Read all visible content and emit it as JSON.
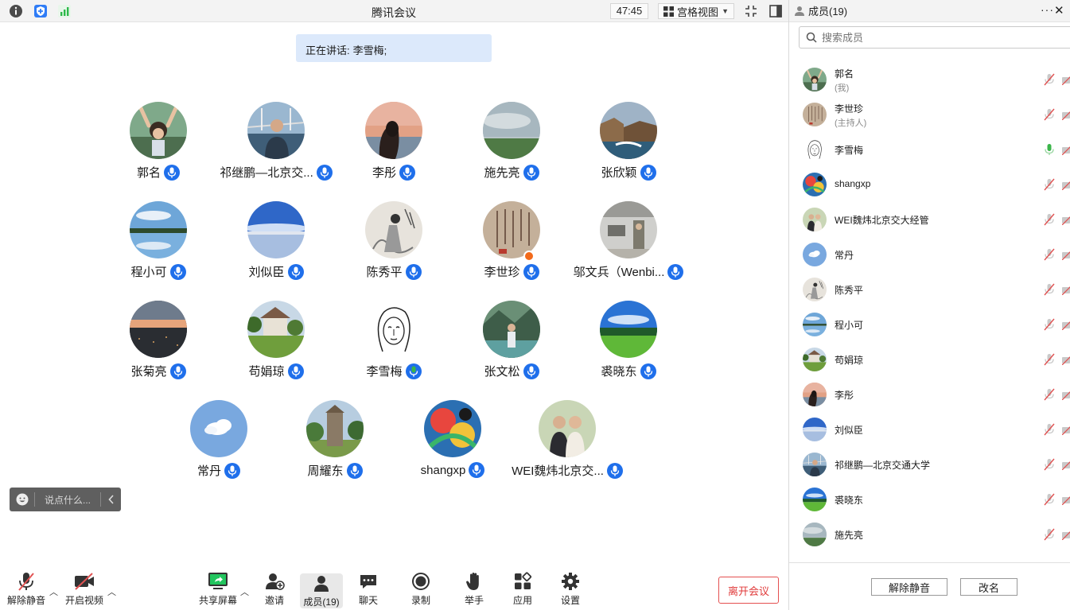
{
  "topbar": {
    "title": "腾讯会议",
    "timer": "47:45",
    "view_mode": "宫格视图"
  },
  "speaking": {
    "label": "正在讲话:",
    "name": "李雪梅;"
  },
  "participants": [
    {
      "name": "郭名",
      "avatar": "child-photo"
    },
    {
      "name": "祁继鹏—北京交...",
      "avatar": "bridge-portrait"
    },
    {
      "name": "李彤",
      "avatar": "sunset-portrait"
    },
    {
      "name": "施先亮",
      "avatar": "prairie-sky"
    },
    {
      "name": "张欣颖",
      "avatar": "coastal-cliffs"
    },
    {
      "name": "程小可",
      "avatar": "lake-reflection"
    },
    {
      "name": "刘似臣",
      "avatar": "salt-lake"
    },
    {
      "name": "陈秀平",
      "avatar": "ink-painting"
    },
    {
      "name": "李世珍",
      "avatar": "calligraphy",
      "host": true
    },
    {
      "name": "邬文兵（Wenbi...",
      "avatar": "gallery"
    },
    {
      "name": "张菊亮",
      "avatar": "dusk-city"
    },
    {
      "name": "苟娟琼",
      "avatar": "garden-pavilion"
    },
    {
      "name": "李雪梅",
      "avatar": "sketch-face",
      "speaking": true
    },
    {
      "name": "张文松",
      "avatar": "mountain-person"
    },
    {
      "name": "裘晓东",
      "avatar": "green-field"
    },
    {
      "name": "常丹",
      "avatar": "blue-cloud"
    },
    {
      "name": "周耀东",
      "avatar": "tower"
    },
    {
      "name": "shangxp",
      "avatar": "colorful-art"
    },
    {
      "name": "WEI魏炜北京交...",
      "avatar": "couple"
    }
  ],
  "chat": {
    "placeholder": "说点什么..."
  },
  "toolbar": {
    "unmute": "解除静音",
    "video": "开启视频",
    "share": "共享屏幕",
    "invite": "邀请",
    "members": "成员(19)",
    "chat": "聊天",
    "record": "录制",
    "raise_hand": "举手",
    "apps": "应用",
    "settings": "设置",
    "leave": "离开会议"
  },
  "panel": {
    "title": "成员(19)",
    "more": "···",
    "search_placeholder": "搜索成员",
    "members": [
      {
        "name": "郭名",
        "role": "(我)",
        "avatar": "child-photo"
      },
      {
        "name": "李世珍",
        "role": "(主持人)",
        "avatar": "calligraphy"
      },
      {
        "name": "李雪梅",
        "avatar": "sketch-face",
        "speaking": true
      },
      {
        "name": "shangxp",
        "avatar": "colorful-art"
      },
      {
        "name": "WEI魏炜北京交大经管",
        "avatar": "couple"
      },
      {
        "name": "常丹",
        "avatar": "blue-cloud"
      },
      {
        "name": "陈秀平",
        "avatar": "ink-painting"
      },
      {
        "name": "程小可",
        "avatar": "lake-reflection"
      },
      {
        "name": "苟娟琼",
        "avatar": "garden-pavilion"
      },
      {
        "name": "李彤",
        "avatar": "sunset-portrait"
      },
      {
        "name": "刘似臣",
        "avatar": "salt-lake"
      },
      {
        "name": "祁继鹏—北京交通大学",
        "avatar": "bridge-portrait"
      },
      {
        "name": "裘晓东",
        "avatar": "green-field"
      },
      {
        "name": "施先亮",
        "avatar": "prairie-sky"
      }
    ],
    "unmute_all": "解除静音",
    "rename": "改名"
  },
  "colors": {
    "accent": "#1f6feb",
    "speaking_bg": "#dce9fb",
    "leave": "#e03a3a",
    "mic_active": "#3bb54a",
    "mic_muted": "#e05252"
  }
}
